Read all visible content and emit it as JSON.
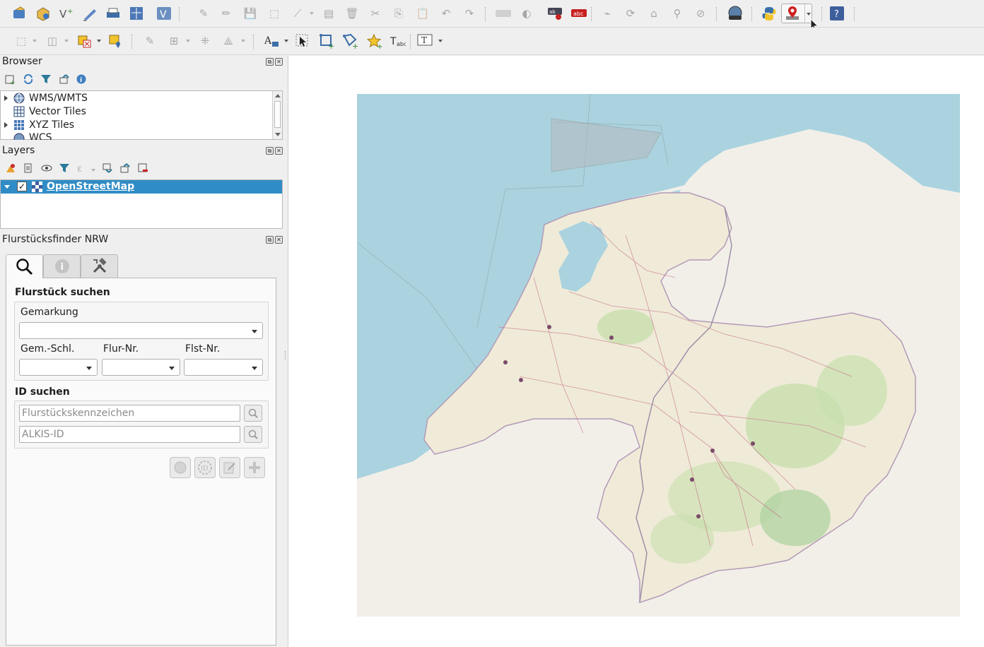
{
  "toolbar1": {
    "icons": [
      "open-project-icon",
      "new-project-icon",
      "new-shapefile-icon",
      "digitize-icon",
      "new-print-layout-icon",
      "identify-features-icon",
      "vector-layer-icon",
      "edits-icon",
      "pencil-icon",
      "save-edits-icon",
      "add-feature-icon",
      "vertex-tool-icon",
      "modify-attributes-icon",
      "delete-selected-icon",
      "cut-features-icon",
      "copy-features-icon",
      "paste-features-icon",
      "undo-icon",
      "redo-icon",
      "label-tool-icon",
      "label-toolbar-icon",
      "abc-pin-icon",
      "abc-red-icon",
      "move-label-icon",
      "rotate-label-icon",
      "change-label-icon",
      "pin-label-icon",
      "show-hide-labels-icon",
      "plugin-globe-icon",
      "python-console-icon",
      "location-pin-icon",
      "help-icon"
    ]
  },
  "toolbar2": {
    "icons": [
      "select-features-icon",
      "select-by-value-icon",
      "deselect-icon",
      "select-location-icon",
      "advanced-digitize-icon",
      "split-features-icon",
      "offset-curve-icon",
      "reshape-icon",
      "annotation-text-icon",
      "select-pointer-icon",
      "add-ring-icon",
      "add-part-icon",
      "star-icon",
      "text-annotation-icon",
      "text-box-icon"
    ]
  },
  "browser": {
    "title": "Browser",
    "items": [
      {
        "label": "WMS/WMTS",
        "icon": "globe-icon",
        "expandable": true
      },
      {
        "label": "Vector Tiles",
        "icon": "grid-icon",
        "expandable": false
      },
      {
        "label": "XYZ Tiles",
        "icon": "xyz-grid-icon",
        "expandable": true
      },
      {
        "label": "WCS",
        "icon": "globe-icon",
        "expandable": false
      }
    ]
  },
  "layers": {
    "title": "Layers",
    "items": [
      {
        "label": "OpenStreetMap",
        "checked": true,
        "selected": true
      }
    ]
  },
  "finder": {
    "title": "Flurstücksfinder NRW",
    "tabs": [
      {
        "name": "search-tab",
        "icon": "magnifier-icon"
      },
      {
        "name": "info-tab",
        "icon": "info-icon"
      },
      {
        "name": "settings-tab",
        "icon": "tools-icon"
      }
    ],
    "search_title": "Flurstück suchen",
    "gemarkung_label": "Gemarkung",
    "gem_schl_label": "Gem.-Schl.",
    "flur_nr_label": "Flur-Nr.",
    "flst_nr_label": "Flst-Nr.",
    "id_title": "ID suchen",
    "kennzeichen_placeholder": "Flurstückskennzeichen",
    "alkis_placeholder": "ALKIS-ID"
  },
  "colors": {
    "selection": "#308cc6",
    "sea": "#aad3df",
    "land": "#f2efe9",
    "forest": "#c8dfae"
  }
}
